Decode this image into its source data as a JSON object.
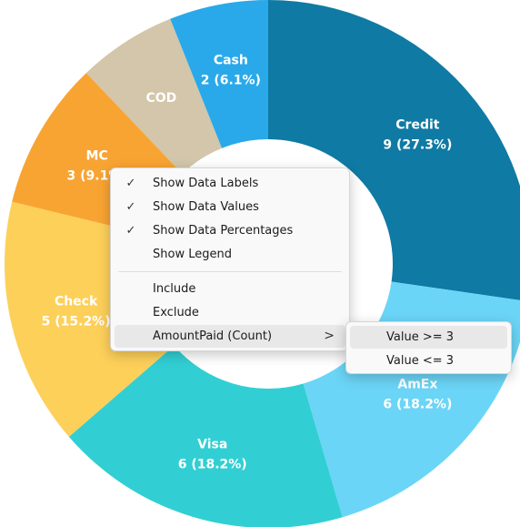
{
  "chart_data": {
    "type": "pie",
    "donut": true,
    "title": "",
    "slices": [
      {
        "label": "Credit",
        "value_text": "9 (27.3%)",
        "value": 9,
        "percent": 27.3,
        "color": "#0f7aa4"
      },
      {
        "label": "AmEx",
        "value_text": "6 (18.2%)",
        "value": 6,
        "percent": 18.2,
        "color": "#6bd5f7"
      },
      {
        "label": "Visa",
        "value_text": "6 (18.2%)",
        "value": 6,
        "percent": 18.2,
        "color": "#31cfd3"
      },
      {
        "label": "Check",
        "value_text": "5 (15.2%)",
        "value": 5,
        "percent": 15.2,
        "color": "#fdd05a"
      },
      {
        "label": "MC",
        "value_text": "3 (9.1%)",
        "value": 3,
        "percent": 9.1,
        "color": "#f8a433"
      },
      {
        "label": "COD",
        "value_text": "",
        "value": 2,
        "percent": 6.1,
        "color": "#d3c6aa"
      },
      {
        "label": "Cash",
        "value_text": "2 (6.1%)",
        "value": 2,
        "percent": 6.1,
        "color": "#29a9ea"
      }
    ]
  },
  "context_menu": {
    "items": [
      {
        "label": "Show Data Labels",
        "checked": true,
        "check_glyph": "✓"
      },
      {
        "label": "Show Data Values",
        "checked": true,
        "check_glyph": "✓"
      },
      {
        "label": "Show Data Percentages",
        "checked": true,
        "check_glyph": "✓"
      },
      {
        "label": "Show Legend",
        "checked": false,
        "check_glyph": ""
      }
    ],
    "actions": [
      {
        "label": "Include"
      },
      {
        "label": "Exclude"
      },
      {
        "label": "AmountPaid (Count)",
        "submenu_arrow": ">"
      }
    ]
  },
  "submenu": {
    "items": [
      {
        "label": "Value >= 3"
      },
      {
        "label": "Value <= 3"
      }
    ]
  }
}
